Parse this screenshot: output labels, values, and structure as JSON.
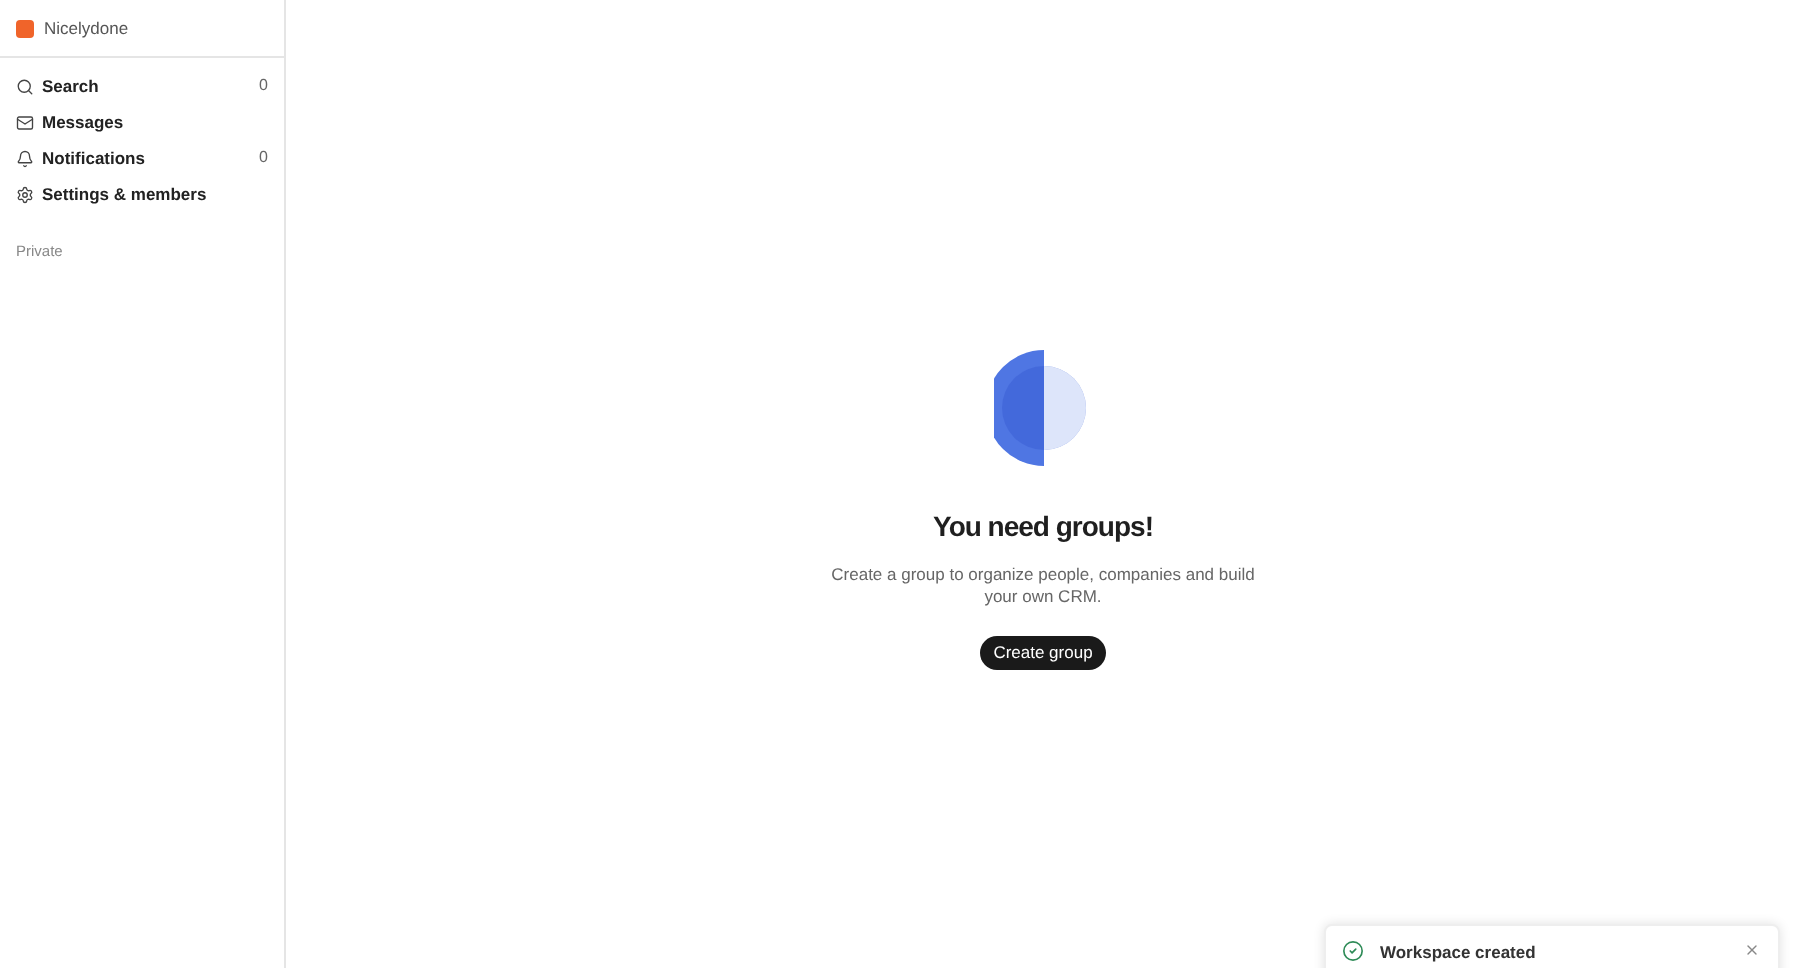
{
  "workspace": {
    "name": "Nicelydone"
  },
  "sidebar": {
    "items": [
      {
        "kind": "search",
        "label": "Search",
        "count": "0"
      },
      {
        "kind": "messages",
        "label": "Messages"
      },
      {
        "kind": "notifications",
        "label": "Notifications",
        "count": "0"
      },
      {
        "kind": "settings",
        "label": "Settings & members"
      }
    ],
    "section": "Private"
  },
  "empty_state": {
    "title": "You need groups!",
    "description": "Create a group to organize people, companies and build your own CRM.",
    "button": "Create group"
  },
  "toast": {
    "message": "Workspace created"
  }
}
